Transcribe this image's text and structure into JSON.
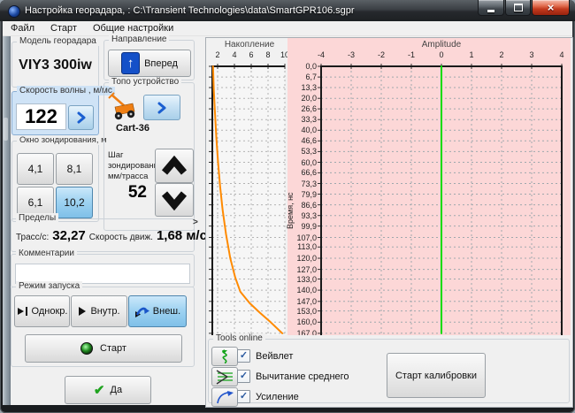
{
  "window": {
    "title": "Настройка георадара, : C:\\Transient Technologies\\data\\SmartGPR106.sgpr",
    "close_glyph": "×"
  },
  "menu": {
    "file": "Файл",
    "start": "Старт",
    "settings": "Общие настройки"
  },
  "panel": {
    "model_label": "Модель георадара",
    "model_value": "VIY3 300iw",
    "velocity_label": "Скорость волны , м/мс",
    "velocity_value": "122",
    "window_label": "Окно зондирования, м",
    "window_options": [
      "4,1",
      "8,1",
      "6,1",
      "10,2"
    ],
    "window_selected": "10,2",
    "direction_label": "Направление",
    "direction_value": "Вперед",
    "direction_arrow": "↑",
    "topo_label": "Топо устройство",
    "topo_device": "Cart-36",
    "step_label_1": "Шаг",
    "step_label_2": "зондирования",
    "step_label_3": "мм/трасса",
    "step_value": "52",
    "limits_label": "Пределы",
    "traces_label": "Трасс/с:",
    "traces_value": "32,27",
    "speed_label": "Скорость движ.",
    "speed_value": "1,68 м/с",
    "expander": ">",
    "comments_label": "Комментарии",
    "comments_value": "",
    "runmode_label": "Режим запуска",
    "mode_single": "Однокр.",
    "mode_internal": "Внутр.",
    "mode_external": "Внеш.",
    "mode_selected": "Внеш.",
    "start_label": "Старт",
    "ok_label": "Да"
  },
  "tools": {
    "label": "Tools online",
    "cb_wavelet": "Вейвлет",
    "cb_mean": "Вычитание среднего",
    "cb_gain": "Усиление",
    "check_glyph": "✓",
    "checked": [
      true,
      true,
      true
    ],
    "calibrate_label": "Старт калибровки"
  },
  "chart_data": {
    "type": "line",
    "left_chart": {
      "title": "Накопление",
      "x_ticks": [
        2,
        4,
        6,
        8,
        10
      ],
      "xlim": [
        1.3,
        10
      ],
      "grid": true,
      "series": [
        {
          "name": "stacking-vs-time",
          "color": "#ff8a00",
          "points": [
            [
              1.45,
              0
            ],
            [
              1.55,
              15
            ],
            [
              1.7,
              30
            ],
            [
              1.85,
              45
            ],
            [
              2.05,
              60
            ],
            [
              2.3,
              75
            ],
            [
              2.6,
              90
            ],
            [
              3.0,
              105
            ],
            [
              3.5,
              120
            ],
            [
              4.1,
              132
            ],
            [
              4.7,
              141
            ],
            [
              5.8,
              148
            ],
            [
              7.0,
              154
            ],
            [
              8.3,
              160
            ],
            [
              9.7,
              167
            ]
          ]
        }
      ]
    },
    "right_chart": {
      "title": "Amplitude",
      "x_ticks": [
        -4,
        -3,
        -2,
        -1,
        0,
        1,
        2,
        3,
        4
      ],
      "xlim": [
        -4,
        4
      ],
      "grid": true,
      "series": [
        {
          "name": "zero-amplitude-trace",
          "color": "#00dc00",
          "points": [
            [
              0,
              0
            ],
            [
              0,
              167
            ]
          ]
        }
      ]
    },
    "y_axis": {
      "label": "Время, нс",
      "tick_labels": [
        "0,0",
        "6,7",
        "13,3",
        "20,0",
        "26,6",
        "33,3",
        "40,0",
        "46,6",
        "53,3",
        "60,0",
        "66,6",
        "73,3",
        "79,9",
        "86,6",
        "93,3",
        "99,9",
        "107,0",
        "113,0",
        "120,0",
        "127,0",
        "133,0",
        "140,0",
        "147,0",
        "153,0",
        "160,0",
        "167,0"
      ],
      "ylim": [
        0,
        168
      ]
    }
  }
}
